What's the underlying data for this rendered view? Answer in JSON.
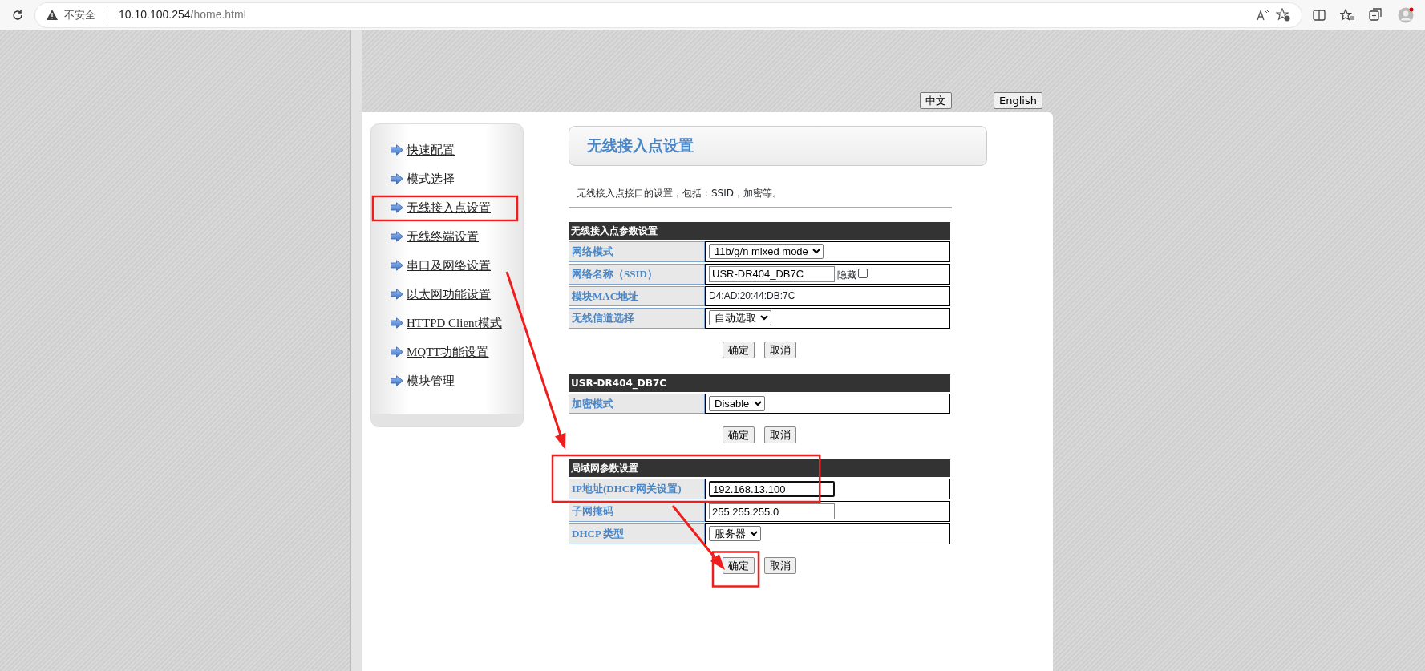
{
  "browser": {
    "security_label": "不安全",
    "url_host": "10.10.100.254",
    "url_path": "/home.html"
  },
  "language_buttons": [
    "中文",
    "English"
  ],
  "sidebar": {
    "items": [
      {
        "label": "快速配置"
      },
      {
        "label": "模式选择"
      },
      {
        "label": "无线接入点设置"
      },
      {
        "label": "无线终端设置"
      },
      {
        "label": "串口及网络设置"
      },
      {
        "label": "以太网功能设置"
      },
      {
        "label": "HTTPD Client模式"
      },
      {
        "label": "MQTT功能设置"
      },
      {
        "label": "模块管理"
      }
    ]
  },
  "page_title": "无线接入点设置",
  "description": "无线接入点接口的设置，包括：SSID，加密等。",
  "sections": [
    {
      "title": "无线接入点参数设置",
      "rows": [
        {
          "label": "网络模式",
          "kind": "select",
          "value": "11b/g/n mixed mode"
        },
        {
          "label": "网络名称（SSID）",
          "kind": "text",
          "value": "USR-DR404_DB7C",
          "focused": false,
          "checkbox_label": "隐藏",
          "checked": false
        },
        {
          "label": "模块MAC地址",
          "kind": "static",
          "value": "D4:AD:20:44:DB:7C"
        },
        {
          "label": "无线信道选择",
          "kind": "select",
          "value": "自动选取"
        }
      ],
      "buttons": [
        "确定",
        "取消"
      ]
    },
    {
      "title": "USR-DR404_DB7C",
      "rows": [
        {
          "label": "加密模式",
          "kind": "select",
          "value": "Disable"
        }
      ],
      "buttons": [
        "确定",
        "取消"
      ]
    },
    {
      "title": "局域网参数设置",
      "rows": [
        {
          "label": "IP地址(DHCP网关设置)",
          "kind": "text",
          "value": "192.168.13.100",
          "focused": true
        },
        {
          "label": "子网掩码",
          "kind": "text",
          "value": "255.255.255.0",
          "focused": false
        },
        {
          "label": "DHCP 类型",
          "kind": "select",
          "value": "服务器"
        }
      ],
      "buttons": [
        "确定",
        "取消"
      ]
    }
  ]
}
